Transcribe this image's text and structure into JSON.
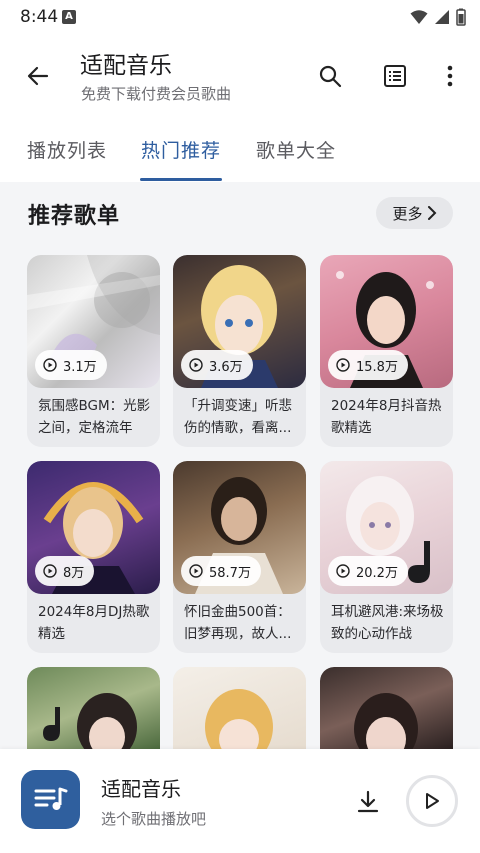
{
  "status_bar": {
    "time": "8:44",
    "notif_letter": "A"
  },
  "header": {
    "title": "适配音乐",
    "subtitle": "免费下载付费会员歌曲",
    "icons": [
      "back-arrow-icon",
      "search-icon",
      "list-icon",
      "more-vert-icon"
    ]
  },
  "tabs": [
    {
      "label": "播放列表"
    },
    {
      "label": "热门推荐"
    },
    {
      "label": "歌单大全"
    }
  ],
  "section": {
    "title": "推荐歌单",
    "more_label": "更多"
  },
  "playlists": [
    {
      "plays": "3.1万",
      "title": "氛围感BGM：光影之间，定格流年"
    },
    {
      "plays": "3.6万",
      "title": "「升调变速」听悲伤的情歌，看离..."
    },
    {
      "plays": "15.8万",
      "title": "2024年8月抖音热歌精选"
    },
    {
      "plays": "8万",
      "title": "2024年8月DJ热歌精选"
    },
    {
      "plays": "58.7万",
      "title": "怀旧金曲500首：旧梦再现，故人..."
    },
    {
      "plays": "20.2万",
      "title": "耳机避风港:来场极致的心动作战"
    }
  ],
  "player": {
    "title": "适配音乐",
    "subtitle": "选个歌曲播放吧"
  },
  "colors": {
    "accent": "#2e5d9f",
    "player_art": "#2f5f9e"
  }
}
